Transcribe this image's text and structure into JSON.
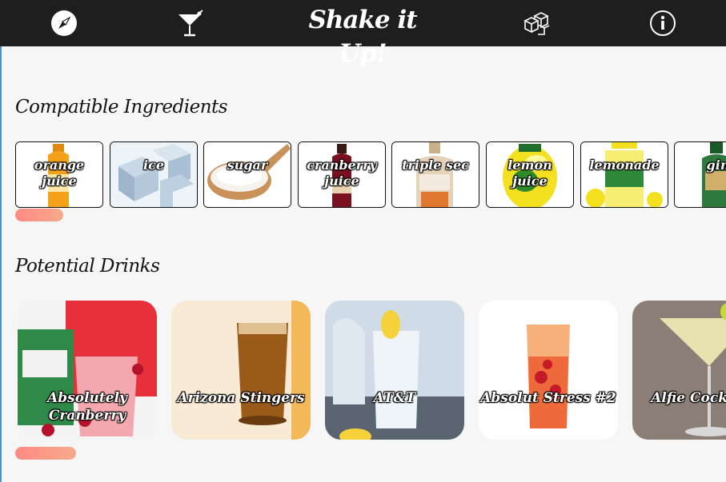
{
  "app": {
    "title": "Shake it Up!",
    "nav": [
      {
        "icon": "compass-icon",
        "label": ""
      },
      {
        "icon": "cocktail-glass-icon",
        "label": ""
      },
      {
        "icon": "ice-cubes-icon",
        "label": ""
      },
      {
        "icon": "info-icon",
        "label": ""
      }
    ]
  },
  "ingredients_section": {
    "title": "Compatible Ingredients",
    "items": [
      {
        "label": "orange juice",
        "image": "orange-juice-bottle"
      },
      {
        "label": "ice",
        "image": "ice-cubes"
      },
      {
        "label": "sugar",
        "image": "sugar-spoon"
      },
      {
        "label": "cranberry juice",
        "image": "cranberry-juice-bottle"
      },
      {
        "label": "triple sec",
        "image": "triple-sec-bottle"
      },
      {
        "label": "lemon juice",
        "image": "lemon-juice-bottle"
      },
      {
        "label": "lemonade",
        "image": "lemonade-bottle"
      },
      {
        "label": "gin",
        "image": "gin-bottle"
      }
    ]
  },
  "drinks_section": {
    "title": "Potential Drinks",
    "items": [
      {
        "label": "Absolutely Cranberry",
        "image": "cranberry-drink"
      },
      {
        "label": "Arizona Stingers",
        "image": "iced-tea-drink"
      },
      {
        "label": "AT&T",
        "image": "clear-highball-drink"
      },
      {
        "label": "Absolut Stress #2",
        "image": "layered-orange-drink"
      },
      {
        "label": "Alfie Cocktail",
        "image": "martini-drink"
      }
    ]
  },
  "colors": {
    "navbar": "#1e1e1e",
    "background": "#f6f6f6",
    "scrollbar_start": "#ff8a86",
    "scrollbar_end": "#f7a988",
    "accent_edge": "#4a8fd6"
  }
}
